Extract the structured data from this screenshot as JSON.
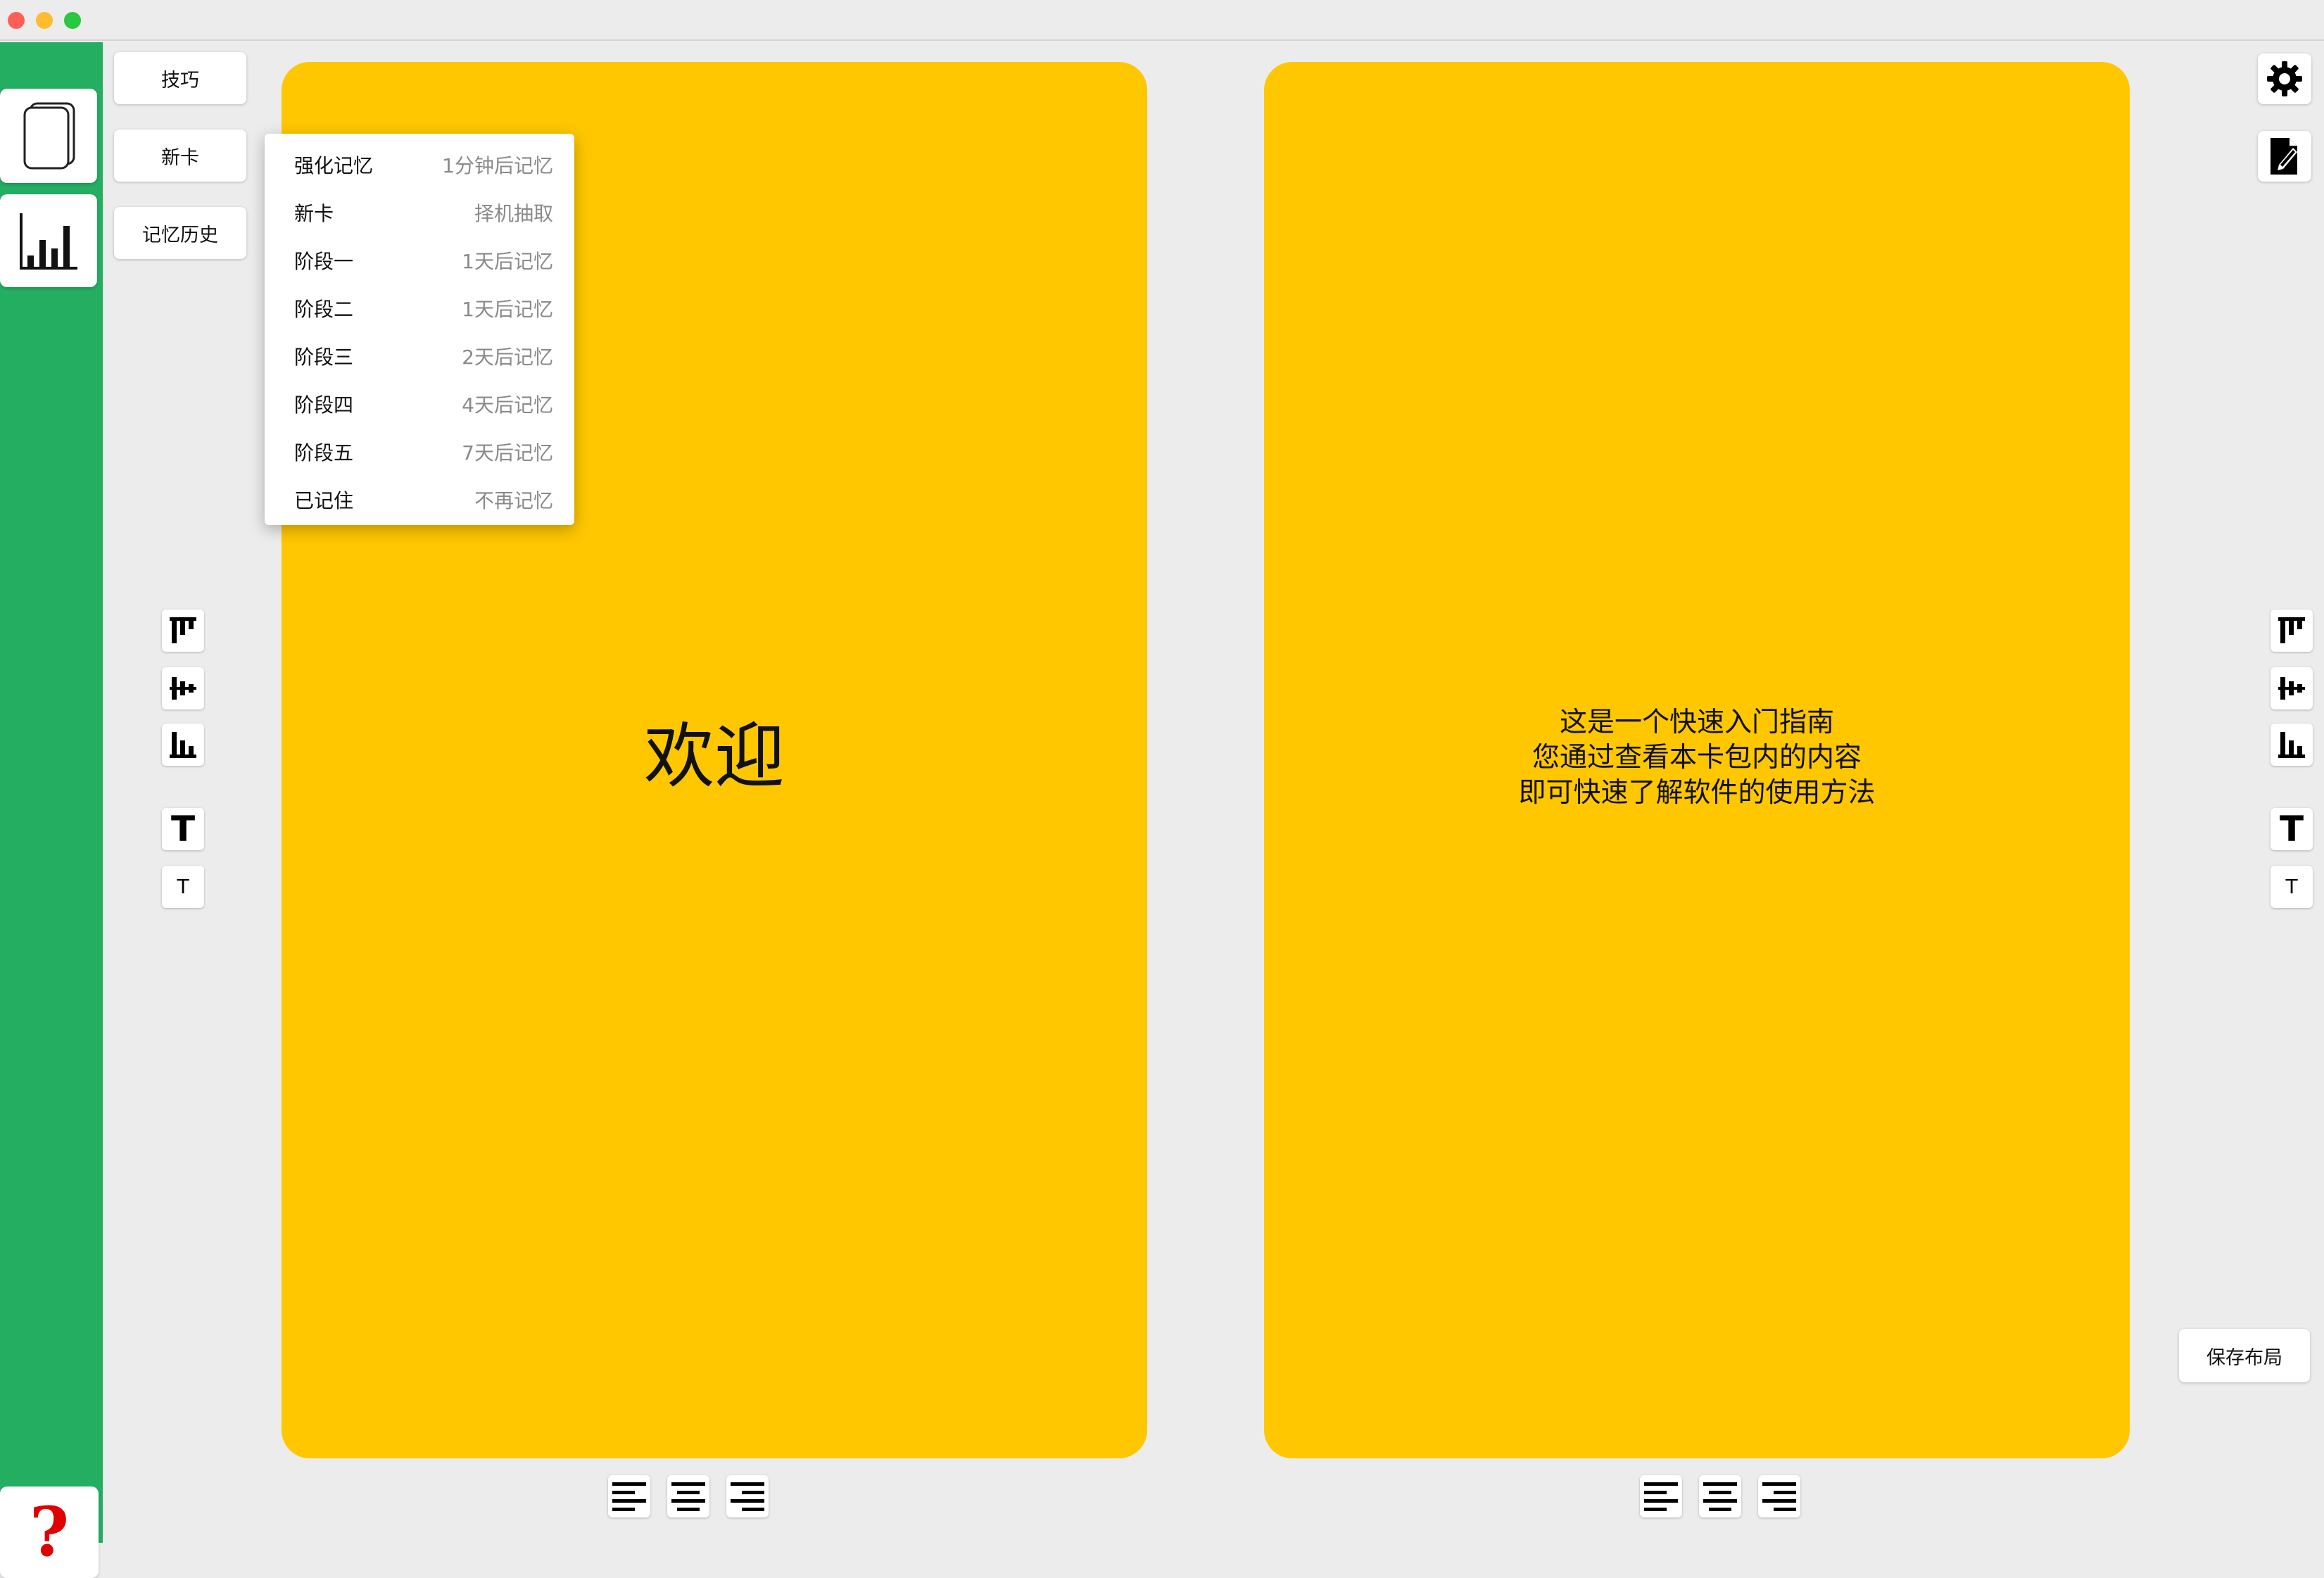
{
  "sidebar": {
    "items": [
      {
        "name": "cards-icon"
      },
      {
        "name": "bar-chart-icon"
      },
      {
        "name": "question-mark-icon",
        "label": "?"
      }
    ]
  },
  "menu_buttons": {
    "tips": "技巧",
    "new_card": "新卡",
    "history": "记忆历史"
  },
  "dropdown": {
    "items": [
      {
        "label": "强化记忆",
        "value": "1分钟后记忆"
      },
      {
        "label": "新卡",
        "value": "择机抽取"
      },
      {
        "label": "阶段一",
        "value": "1天后记忆"
      },
      {
        "label": "阶段二",
        "value": "1天后记忆"
      },
      {
        "label": "阶段三",
        "value": "2天后记忆"
      },
      {
        "label": "阶段四",
        "value": "4天后记忆"
      },
      {
        "label": "阶段五",
        "value": "7天后记忆"
      },
      {
        "label": "已记住",
        "value": "不再记忆"
      }
    ]
  },
  "card_front": {
    "text": "欢迎"
  },
  "card_back": {
    "lines": [
      "这是一个快速入门指南",
      "您通过查看本卡包内的内容",
      "即可快速了解软件的使用方法"
    ]
  },
  "tools": {
    "text_size_large": "T",
    "text_size_small": "T"
  },
  "save_layout": "保存布局",
  "colors": {
    "sidebar": "#23ae62",
    "card": "#fec700",
    "background": "#ececec",
    "help_icon": "#e00000"
  }
}
